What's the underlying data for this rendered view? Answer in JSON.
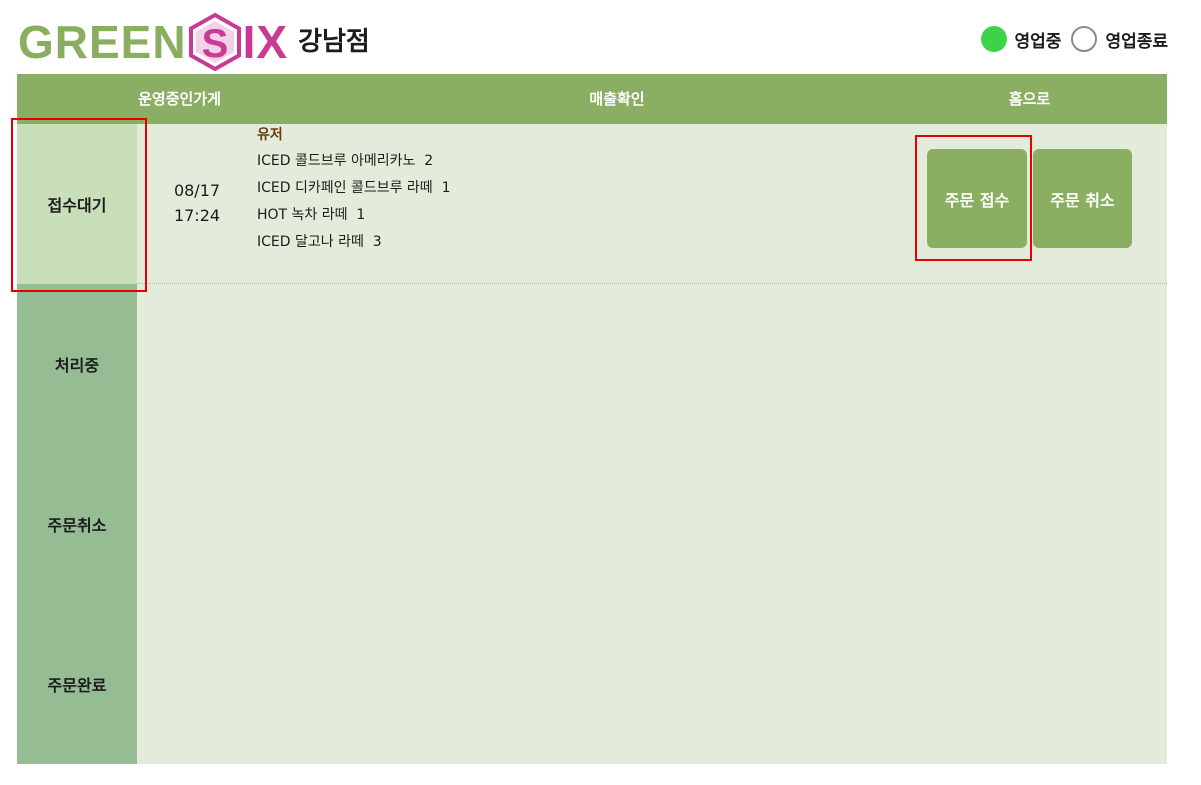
{
  "header": {
    "logo": {
      "green_text": "GREEN",
      "hex_letter": "S",
      "pink_text": "IX",
      "colors": {
        "green": "#8aae5f",
        "pink": "#c83a94"
      }
    },
    "branch_name": "강남점",
    "status": {
      "open_label": "영업중",
      "closed_label": "영업종료",
      "selected": "open",
      "colors": {
        "open": "#3ed24a"
      }
    }
  },
  "nav": {
    "items": [
      {
        "label": "운영중인가게"
      },
      {
        "label": "매출확인"
      },
      {
        "label": "홈으로"
      }
    ],
    "color": "#8aae62"
  },
  "sidebar": {
    "items": [
      {
        "label": "접수대기",
        "active": true
      },
      {
        "label": "처리중"
      },
      {
        "label": "주문취소"
      },
      {
        "label": "주문완료"
      }
    ]
  },
  "orders": [
    {
      "date": "08/17",
      "time": "17:24",
      "customer": "유저",
      "items": [
        "ICED 콜드브루 아메리카노  2",
        "ICED 디카페인 콜드브루 라떼  1",
        "HOT 녹차 라떼  1",
        "ICED 달고나 라떼  3"
      ],
      "accept_label": "주문 접수",
      "cancel_label": "주문 취소"
    }
  ]
}
